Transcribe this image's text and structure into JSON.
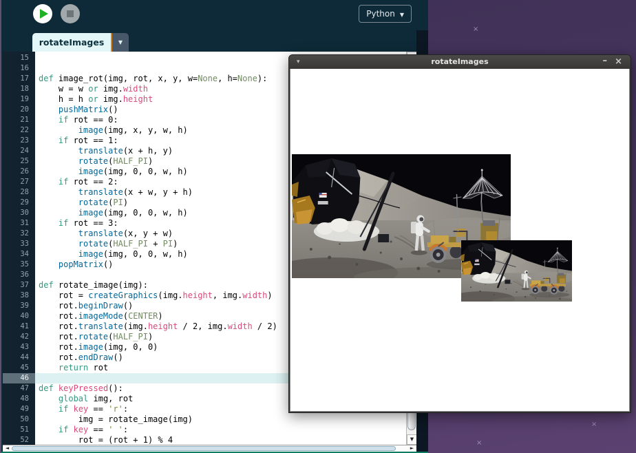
{
  "toolbar": {
    "mode_button": "Python",
    "mode_caret": "▼"
  },
  "tab_bar": {
    "active_tab": "rotateImages",
    "tab_menu_caret": "▼"
  },
  "editor": {
    "current_line": 46,
    "lines": [
      {
        "n": 15,
        "t": []
      },
      {
        "n": 16,
        "t": []
      },
      {
        "n": 17,
        "t": [
          [
            "kw",
            "def"
          ],
          [
            "pl",
            " image_rot(img, rot, x, y, w="
          ],
          [
            "cn",
            "None"
          ],
          [
            "pl",
            ", h="
          ],
          [
            "cn",
            "None"
          ],
          [
            "pl",
            "):"
          ]
        ]
      },
      {
        "n": 18,
        "t": [
          [
            "pl",
            "    w = w "
          ],
          [
            "kw",
            "or"
          ],
          [
            "pl",
            " img."
          ],
          [
            "vr",
            "width"
          ]
        ]
      },
      {
        "n": 19,
        "t": [
          [
            "pl",
            "    h = h "
          ],
          [
            "kw",
            "or"
          ],
          [
            "pl",
            " img."
          ],
          [
            "vr",
            "height"
          ]
        ]
      },
      {
        "n": 20,
        "t": [
          [
            "pl",
            "    "
          ],
          [
            "fn",
            "pushMatrix"
          ],
          [
            "pl",
            "()"
          ]
        ]
      },
      {
        "n": 21,
        "t": [
          [
            "pl",
            "    "
          ],
          [
            "kw",
            "if"
          ],
          [
            "pl",
            " rot == 0:"
          ]
        ]
      },
      {
        "n": 22,
        "t": [
          [
            "pl",
            "        "
          ],
          [
            "fn",
            "image"
          ],
          [
            "pl",
            "(img, x, y, w, h)"
          ]
        ]
      },
      {
        "n": 23,
        "t": [
          [
            "pl",
            "    "
          ],
          [
            "kw",
            "if"
          ],
          [
            "pl",
            " rot == 1:"
          ]
        ]
      },
      {
        "n": 24,
        "t": [
          [
            "pl",
            "        "
          ],
          [
            "fn",
            "translate"
          ],
          [
            "pl",
            "(x + h, y)"
          ]
        ]
      },
      {
        "n": 25,
        "t": [
          [
            "pl",
            "        "
          ],
          [
            "fn",
            "rotate"
          ],
          [
            "pl",
            "("
          ],
          [
            "cn",
            "HALF_PI"
          ],
          [
            "pl",
            ")"
          ]
        ]
      },
      {
        "n": 26,
        "t": [
          [
            "pl",
            "        "
          ],
          [
            "fn",
            "image"
          ],
          [
            "pl",
            "(img, 0, 0, w, h)"
          ]
        ]
      },
      {
        "n": 27,
        "t": [
          [
            "pl",
            "    "
          ],
          [
            "kw",
            "if"
          ],
          [
            "pl",
            " rot == 2:"
          ]
        ]
      },
      {
        "n": 28,
        "t": [
          [
            "pl",
            "        "
          ],
          [
            "fn",
            "translate"
          ],
          [
            "pl",
            "(x + w, y + h)"
          ]
        ]
      },
      {
        "n": 29,
        "t": [
          [
            "pl",
            "        "
          ],
          [
            "fn",
            "rotate"
          ],
          [
            "pl",
            "("
          ],
          [
            "cn",
            "PI"
          ],
          [
            "pl",
            ")"
          ]
        ]
      },
      {
        "n": 30,
        "t": [
          [
            "pl",
            "        "
          ],
          [
            "fn",
            "image"
          ],
          [
            "pl",
            "(img, 0, 0, w, h)"
          ]
        ]
      },
      {
        "n": 31,
        "t": [
          [
            "pl",
            "    "
          ],
          [
            "kw",
            "if"
          ],
          [
            "pl",
            " rot == 3:"
          ]
        ]
      },
      {
        "n": 32,
        "t": [
          [
            "pl",
            "        "
          ],
          [
            "fn",
            "translate"
          ],
          [
            "pl",
            "(x, y + w)"
          ]
        ]
      },
      {
        "n": 33,
        "t": [
          [
            "pl",
            "        "
          ],
          [
            "fn",
            "rotate"
          ],
          [
            "pl",
            "("
          ],
          [
            "cn",
            "HALF_PI"
          ],
          [
            "pl",
            " + "
          ],
          [
            "cn",
            "PI"
          ],
          [
            "pl",
            ")"
          ]
        ]
      },
      {
        "n": 34,
        "t": [
          [
            "pl",
            "        "
          ],
          [
            "fn",
            "image"
          ],
          [
            "pl",
            "(img, 0, 0, w, h)"
          ]
        ]
      },
      {
        "n": 35,
        "t": [
          [
            "pl",
            "    "
          ],
          [
            "fn",
            "popMatrix"
          ],
          [
            "pl",
            "()"
          ]
        ]
      },
      {
        "n": 36,
        "t": []
      },
      {
        "n": 37,
        "t": [
          [
            "kw",
            "def"
          ],
          [
            "pl",
            " rotate_image(img):"
          ]
        ]
      },
      {
        "n": 38,
        "t": [
          [
            "pl",
            "    rot = "
          ],
          [
            "fn",
            "createGraphics"
          ],
          [
            "pl",
            "(img."
          ],
          [
            "vr",
            "height"
          ],
          [
            "pl",
            ", img."
          ],
          [
            "vr",
            "width"
          ],
          [
            "pl",
            ")"
          ]
        ]
      },
      {
        "n": 39,
        "t": [
          [
            "pl",
            "    rot."
          ],
          [
            "fn",
            "beginDraw"
          ],
          [
            "pl",
            "()"
          ]
        ]
      },
      {
        "n": 40,
        "t": [
          [
            "pl",
            "    rot."
          ],
          [
            "fn",
            "imageMode"
          ],
          [
            "pl",
            "("
          ],
          [
            "cn",
            "CENTER"
          ],
          [
            "pl",
            ")"
          ]
        ]
      },
      {
        "n": 41,
        "t": [
          [
            "pl",
            "    rot."
          ],
          [
            "fn",
            "translate"
          ],
          [
            "pl",
            "(img."
          ],
          [
            "vr",
            "height"
          ],
          [
            "pl",
            " / 2, img."
          ],
          [
            "vr",
            "width"
          ],
          [
            "pl",
            " / 2)"
          ]
        ]
      },
      {
        "n": 42,
        "t": [
          [
            "pl",
            "    rot."
          ],
          [
            "fn",
            "rotate"
          ],
          [
            "pl",
            "("
          ],
          [
            "cn",
            "HALF_PI"
          ],
          [
            "pl",
            ")"
          ]
        ]
      },
      {
        "n": 43,
        "t": [
          [
            "pl",
            "    rot."
          ],
          [
            "fn",
            "image"
          ],
          [
            "pl",
            "(img, 0, 0)"
          ]
        ]
      },
      {
        "n": 44,
        "t": [
          [
            "pl",
            "    rot."
          ],
          [
            "fn",
            "endDraw"
          ],
          [
            "pl",
            "()"
          ]
        ]
      },
      {
        "n": 45,
        "t": [
          [
            "pl",
            "    "
          ],
          [
            "kw",
            "return"
          ],
          [
            "pl",
            " rot"
          ]
        ]
      },
      {
        "n": 46,
        "t": []
      },
      {
        "n": 47,
        "t": [
          [
            "kw",
            "def"
          ],
          [
            "pl",
            " "
          ],
          [
            "vr",
            "keyPressed"
          ],
          [
            "pl",
            "():"
          ]
        ]
      },
      {
        "n": 48,
        "t": [
          [
            "pl",
            "    "
          ],
          [
            "kw",
            "global"
          ],
          [
            "pl",
            " img, rot"
          ]
        ]
      },
      {
        "n": 49,
        "t": [
          [
            "pl",
            "    "
          ],
          [
            "kw",
            "if"
          ],
          [
            "pl",
            " "
          ],
          [
            "vr",
            "key"
          ],
          [
            "pl",
            " == "
          ],
          [
            "st",
            "'r'"
          ],
          [
            "pl",
            ":"
          ]
        ]
      },
      {
        "n": 50,
        "t": [
          [
            "pl",
            "        img = rotate_image(img)"
          ]
        ]
      },
      {
        "n": 51,
        "t": [
          [
            "pl",
            "    "
          ],
          [
            "kw",
            "if"
          ],
          [
            "pl",
            " "
          ],
          [
            "vr",
            "key"
          ],
          [
            "pl",
            " == "
          ],
          [
            "st",
            "' '"
          ],
          [
            "pl",
            ":"
          ]
        ]
      },
      {
        "n": 52,
        "t": [
          [
            "pl",
            "        rot = (rot + 1) % 4"
          ]
        ]
      }
    ]
  },
  "scrollbars": {
    "v_up": "▲",
    "v_down": "▼",
    "h_left": "◄",
    "h_right": "►"
  },
  "sketch_window": {
    "title": "rotateImages",
    "menu_caret": "▾",
    "minimize_label": "–",
    "close_label": "×"
  },
  "desktop": {
    "marks": [
      "×",
      "×",
      "×"
    ]
  },
  "colors": {
    "kw": "#33997e",
    "fn": "#006699",
    "vr": "#d94a7b",
    "cn": "#718a62",
    "st": "#7d8a42",
    "current_line_bg": "#ddf1f2",
    "teal_footer": "#0e7d62",
    "tab_active_bg": "#e4f7f8",
    "accent_orange": "#d98324",
    "desktop_purple": "#473560"
  }
}
